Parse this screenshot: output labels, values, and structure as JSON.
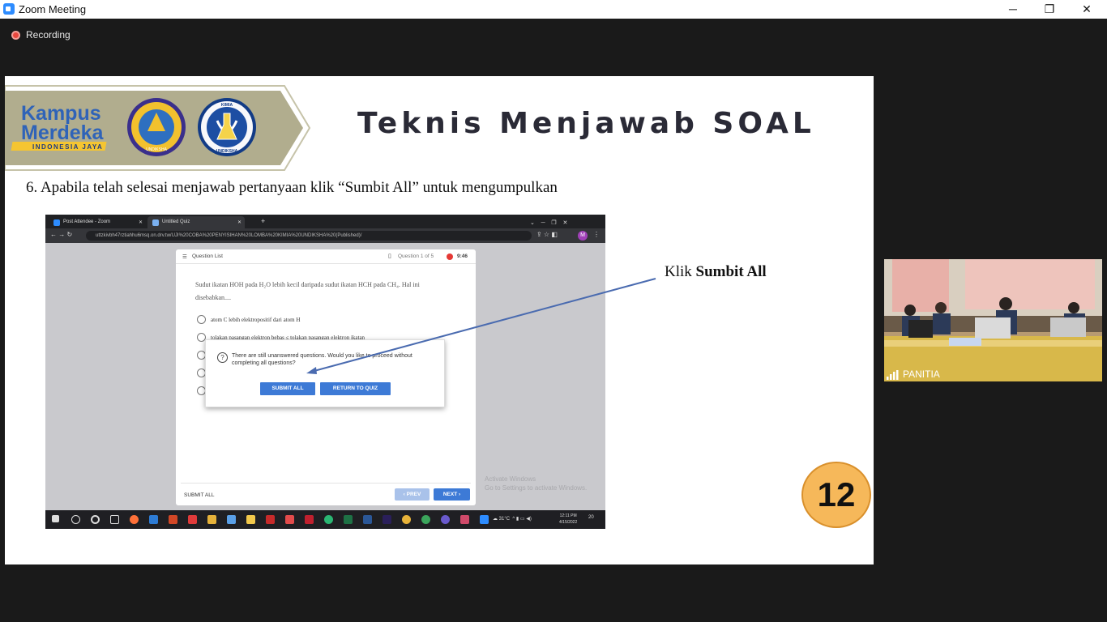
{
  "window": {
    "title": "Zoom Meeting",
    "minimize": "─",
    "restore": "❐",
    "close": "✕"
  },
  "meeting": {
    "recording_label": "Recording",
    "participant_name": "PANITIA"
  },
  "slide": {
    "banner_logo_line1": "Kampus",
    "banner_logo_line2": "Merdeka",
    "banner_logo_tag": "INDONESIA JAYA",
    "seal1_text": "UNDIKSHA",
    "seal2_text_top": "KIMIA",
    "seal2_text_bottom": "UNDIKSHA",
    "title": "Teknis Menjawab SOAL",
    "instruction": "6. Apabila telah selesai menjawab pertanyaan klik “Sumbit All” untuk mengumpulkan",
    "annotation_prefix": "Klik ",
    "annotation_bold": "Sumbit All",
    "page_number": "12"
  },
  "browser": {
    "tabs": [
      {
        "label": "Post Attendee - Zoom",
        "close": "✕"
      },
      {
        "label": "Untitled Quiz",
        "close": "✕"
      }
    ],
    "new_tab": "+",
    "url": "uttzkivbh47rztiahhu6msq.on.drv.tw/UJI%20COBA%20PENYISIHAN%20LOMBA%20KIMIA%20UNDIKSHA%20(Published)/",
    "avatar_letter": "M",
    "quiz": {
      "question_list": "Question List",
      "counter": "Question 1 of 5",
      "timer": "9:46",
      "question_line1": "Sudut ikatan HOH pada H₂O lebih kecil daripada sudut ikatan HCH pada CH₄. Hal ini",
      "question_line2": "disebabkan....",
      "options": [
        "atom C lebih elektropositif dari atom H",
        "tolakan pasangan elektron bebas ≤ tolakan pasangan elektron ikatan",
        "",
        "",
        ""
      ],
      "dialog_message": "There are still unanswered questions. Would you like to proceed without completing all questions?",
      "submit_all_button": "SUBMIT ALL",
      "return_button": "RETURN TO QUIZ",
      "footer_submit": "SUBMIT ALL",
      "prev_button": "‹ PREV",
      "next_button": "NEXT ›"
    },
    "activate_line1": "Activate Windows",
    "activate_line2": "Go to Settings to activate Windows.",
    "taskbar": {
      "weather": "31°C",
      "time": "12:11 PM",
      "date": "4/15/2022",
      "notifications": "20"
    }
  },
  "colors": {
    "accent_blue": "#3d7ad6",
    "badge_orange": "#f6b85a",
    "banner_khaki": "#b1ad8e",
    "recording_red": "#e8473e"
  }
}
